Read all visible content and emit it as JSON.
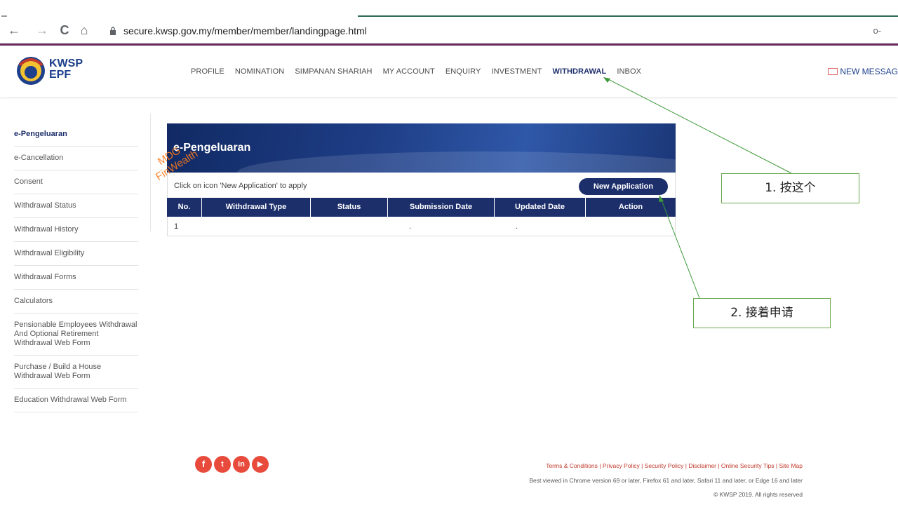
{
  "browser": {
    "back_icon": "←",
    "forward_icon": "→",
    "reload_icon": "C",
    "home_icon": "⌂",
    "url": "secure.kwsp.gov.my/member/member/landingpage.html",
    "key_icon": "o-"
  },
  "header": {
    "logo_line1": "KWSP",
    "logo_line2": "EPF",
    "nav": [
      "PROFILE",
      "NOMINATION",
      "SIMPANAN SHARIAH",
      "MY ACCOUNT",
      "ENQUIRY",
      "INVESTMENT",
      "WITHDRAWAL",
      "INBOX"
    ],
    "active_nav": "WITHDRAWAL",
    "new_message": "NEW MESSAG"
  },
  "sidebar": {
    "items": [
      "e-Pengeluaran",
      "e-Cancellation",
      "Consent",
      "Withdrawal Status",
      "Withdrawal History",
      "Withdrawal Eligibility",
      "Withdrawal Forms",
      "Calculators",
      "Pensionable Employees Withdrawal And Optional Retirement Withdrawal Web Form",
      "Purchase / Build a House Withdrawal Web Form",
      "Education Withdrawal Web Form"
    ],
    "active": "e-Pengeluaran"
  },
  "main": {
    "title": "e-Pengeluaran",
    "instruction": "Click on icon 'New Application' to apply",
    "new_application_label": "New Application",
    "columns": [
      "No.",
      "Withdrawal Type",
      "Status",
      "Submission Date",
      "Updated Date",
      "Action"
    ],
    "rows": [
      {
        "no": "1",
        "type": "",
        "status": "",
        "submission": ".",
        "updated": ".",
        "action": ""
      }
    ]
  },
  "watermark": {
    "line1": "MDG",
    "line2": "FinWealth"
  },
  "annotations": {
    "step1": "1. 按这个",
    "step2": "2. 接着申请"
  },
  "footer": {
    "social": [
      "f",
      "t",
      "in",
      "▶"
    ],
    "links": "Terms & Conditions | Privacy Policy | Security Policy | Disclaimer | Online Security Tips | Site Map",
    "note": "Best viewed in Chrome version 69 or later, Firefox 61 and later, Safari 11 and later, or Edge 16 and later",
    "copyright": "© KWSP 2019. All rights reserved"
  },
  "colors": {
    "brand_navy": "#1d2f6b",
    "header_accent": "#6b2a5c",
    "callout_border": "#6aa84f",
    "watermark": "#ff7a1a"
  }
}
